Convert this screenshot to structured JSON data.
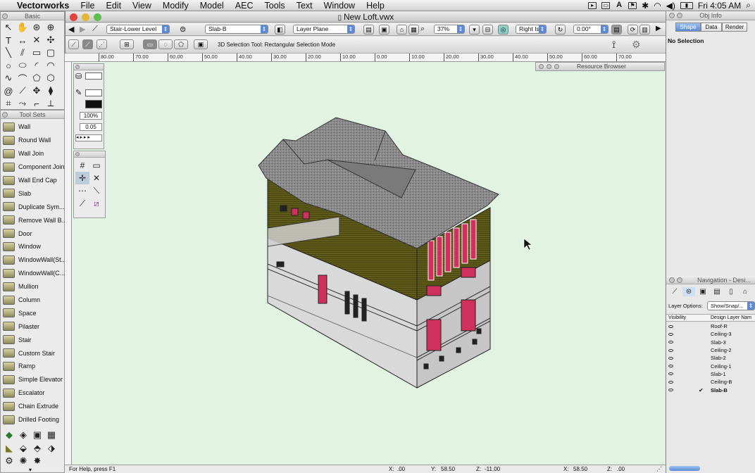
{
  "menubar": {
    "app": "Vectorworks",
    "items": [
      "File",
      "Edit",
      "View",
      "Modify",
      "Model",
      "AEC",
      "Tools",
      "Text",
      "Window",
      "Help"
    ],
    "clock": "Fri 4:05 AM"
  },
  "basic_palette": {
    "title": "Basic"
  },
  "tool_sets": {
    "title": "Tool Sets",
    "tools": [
      "Wall",
      "Round Wall",
      "Wall Join",
      "Component Join",
      "Wall End Cap",
      "Slab",
      "Duplicate Sym...",
      "Remove Wall B...",
      "Door",
      "Window",
      "WindowWall(St...",
      "WindowWall(C...",
      "Mullion",
      "Column",
      "Space",
      "Pilaster",
      "Stair",
      "Custom Stair",
      "Ramp",
      "Simple Elevator",
      "Escalator",
      "Chain Extrude",
      "Drilled Footing"
    ]
  },
  "attributes": {
    "opacity": "100%",
    "line_weight": "0.05"
  },
  "document": {
    "title": "New Loft.vwx",
    "class_menu": "Stair-Lower Level",
    "layer_menu": "Slab-B",
    "plane_menu": "Layer Plane",
    "zoom": "37%",
    "view_menu": "Right Is...",
    "angle": "0.00°",
    "mode_hint": "3D Selection Tool: Rectangular Selection Mode",
    "ruler_ticks": [
      "80.00",
      "70.00",
      "60.00",
      "50.00",
      "40.00",
      "30.00",
      "20.00",
      "10.00",
      "0.00",
      "10.00",
      "20.00",
      "30.00",
      "40.00",
      "50.00",
      "60.00",
      "70.00"
    ]
  },
  "resource_browser": {
    "title": "Resource Browser"
  },
  "status": {
    "help": "For Help, press F1",
    "x_label": "X:",
    "x_value": ".00",
    "y_label": "Y:",
    "y_value": "58.50",
    "z_label": "Z:",
    "z_value": "-11.00",
    "x2_label": "X:",
    "x2_value": "58.50",
    "z2_label": "Z:",
    "z2_value": ".00"
  },
  "obj_info": {
    "title": "Obj Info",
    "tabs": [
      "Shape",
      "Data",
      "Render"
    ],
    "selection": "No Selection"
  },
  "navigation": {
    "title": "Navigation - Desi...",
    "layer_options_label": "Layer Options:",
    "layer_options_value": "Show/Snap/...",
    "col_visibility": "Visibility",
    "col_name": "Design Layer Nam",
    "layers": [
      "Roof-R",
      "Ceiling-3",
      "Slab-3",
      "Ceiling-2",
      "Slab-2",
      "Ceiling-1",
      "Slab-1",
      "Ceiling-B",
      "Slab-B"
    ],
    "active_layer": "Slab-B"
  },
  "colors": {
    "canvas": "#e3f3e3",
    "accent": "#5b8ad6",
    "window_pink": "#d0305e",
    "wall_olive": "#5e5a1a"
  }
}
